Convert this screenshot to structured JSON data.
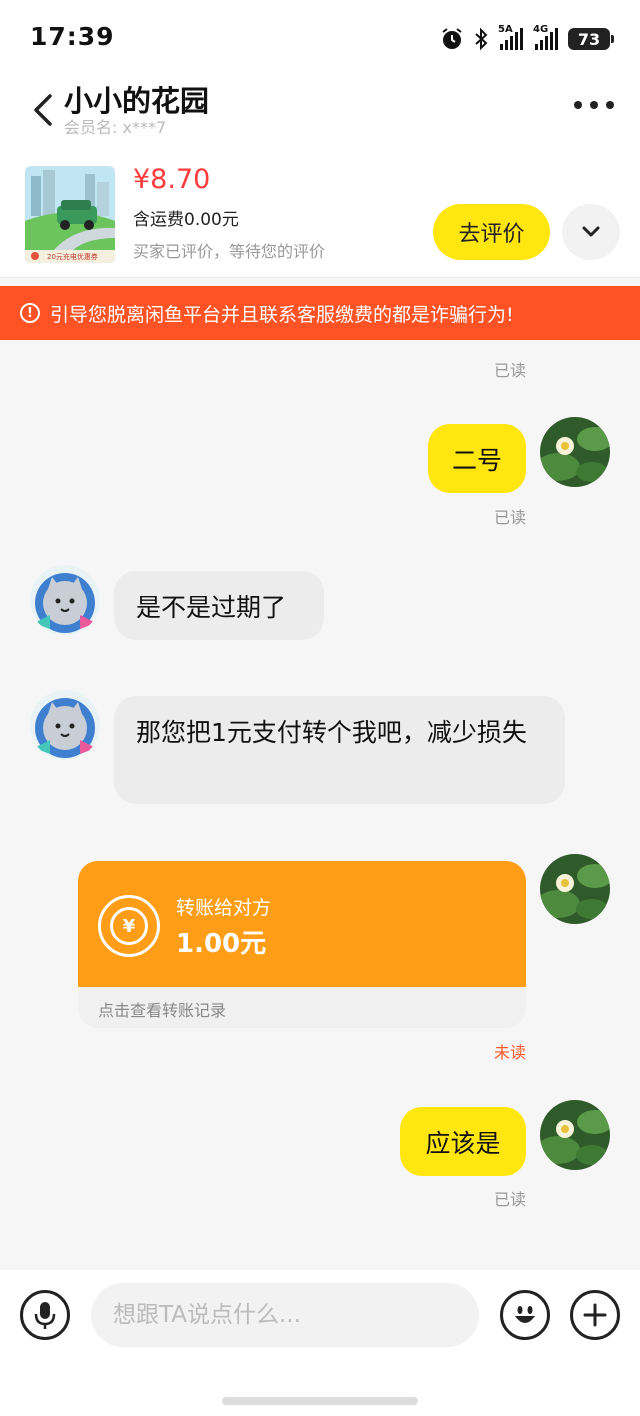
{
  "status_bar": {
    "time": "17:39",
    "battery": "73",
    "sim1": "5A",
    "sim2": "4G"
  },
  "header": {
    "title": "小小的花园",
    "member": "会员名:  x***7"
  },
  "product": {
    "price": "¥8.70",
    "shipping": "含运费0.00元",
    "review_note": "买家已评价，等待您的评价",
    "review_button": "去评价",
    "thumbnail_caption": "20元充电优惠券"
  },
  "warning": {
    "icon": "!",
    "text": "引导您脱离闲鱼平台并且联系客服缴费的都是诈骗行为!"
  },
  "messages": {
    "read_top": "已读",
    "m1_text": "二号",
    "m1_status": "已读",
    "m2_text": "是不是过期了",
    "m3_text": "那您把1元支付转个我吧，减少损失",
    "transfer": {
      "icon_symbol": "¥",
      "label": "转账给对方",
      "amount": "1.00元",
      "link": "点击查看转账记录",
      "status": "未读"
    },
    "m5_text": "应该是",
    "m5_status": "已读"
  },
  "input": {
    "placeholder": "想跟TA说点什么..."
  },
  "colors": {
    "accent_yellow": "#ffe60f",
    "warning_red": "#ff5225",
    "price_red": "#ff3b3b",
    "transfer_orange": "#ff9d16"
  }
}
